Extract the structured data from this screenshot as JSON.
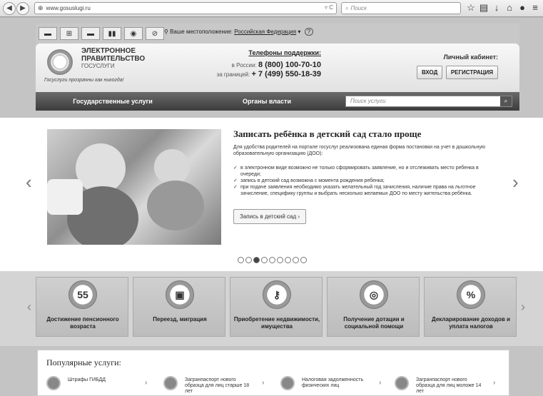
{
  "browser": {
    "back_icon": "back-arrow-icon",
    "forward_icon": "forward-arrow-icon",
    "url": "www.gosuslugi.ru",
    "search_placeholder": "Поиск"
  },
  "toolbar": {
    "location_label": "Ваше местоположение:",
    "location_value": "Российская Федерация",
    "help": "?"
  },
  "header": {
    "brand_line1": "ЭЛЕКТРОННОЕ",
    "brand_line2": "ПРАВИТЕЛЬСТВО",
    "brand_line3": "ГОСУСЛУГИ",
    "tagline": "Госуслуги прозрачны как никогда!",
    "phones_title": "Телефоны поддержки:",
    "phone_ru_label": "в России:",
    "phone_ru": "8 (800) 100-70-10",
    "phone_abroad_label": "за границей:",
    "phone_abroad": "+ 7 (499) 550-18-39",
    "cabinet_title": "Личный кабинет:",
    "login": "ВХОД",
    "register": "РЕГИСТРАЦИЯ"
  },
  "menu": {
    "item1": "Государственные услуги",
    "item2": "Органы власти",
    "search_placeholder": "Поиск услуги"
  },
  "banner": {
    "title": "Записать ребёнка в детский сад стало проще",
    "intro": "Для удобства родителей на портале госуслуг реализована единая форма постановки на учет в дошкольную образовательную организацию (ДОО):",
    "bullets": [
      "в электронном виде возможно не только сформировать заявление, но и отслеживать место ребенка в очереди;",
      "запись в детский сад возможна с момента рождения ребенка;",
      "при подаче заявления необходимо указать желательный год зачисления, наличие права на льготное зачисление, специфику группы и выбрать несколько желаемых ДОО по месту жительства ребёнка."
    ],
    "button": "Запись в детский сад",
    "slide_count": 9,
    "active_slide": 3
  },
  "categories": [
    {
      "label": "Достижение пенсионного возраста",
      "icon": "55"
    },
    {
      "label": "Переезд, миграция",
      "icon": "passport-icon"
    },
    {
      "label": "Приобретение недвижимости, имущества",
      "icon": "keys-icon"
    },
    {
      "label": "Получение дотации и социальной помощи",
      "icon": "lifebuoy-icon"
    },
    {
      "label": "Декларирование доходов и уплата налогов",
      "icon": "%"
    }
  ],
  "popular": {
    "title": "Популярные услуги:",
    "items": [
      {
        "label": "Штрафы ГИБДД"
      },
      {
        "label": "Загранпаспорт нового образца для лиц старше 18 лет"
      },
      {
        "label": "Налоговая задолженность физических лиц"
      },
      {
        "label": "Загранпаспорт нового образца для лиц моложе 14 лет"
      }
    ]
  }
}
